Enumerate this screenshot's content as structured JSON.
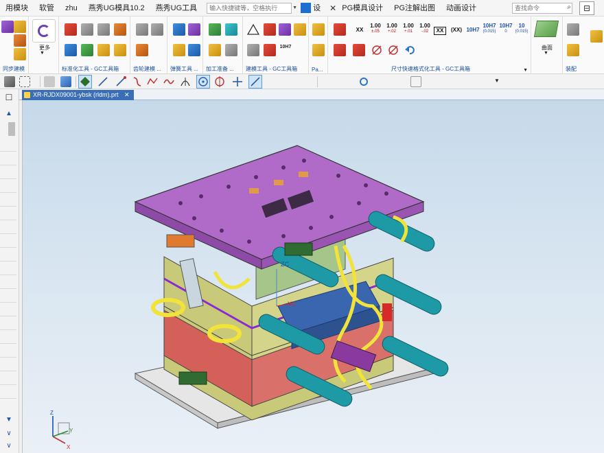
{
  "menubar": {
    "items": [
      "用模块",
      "软管",
      "zhu",
      "燕秀UG模具10.2",
      "燕秀UG工具"
    ],
    "command_placeholder": "输入快捷键等，空格执行",
    "settings_label": "设",
    "right_items": [
      "PG模具设计",
      "PG注解出图",
      "动画设计"
    ],
    "find_placeholder": "查找命令"
  },
  "ribbon": {
    "groups": [
      {
        "label": "同步建模"
      },
      {
        "label": "标准化工具 - GC工具箱"
      },
      {
        "label": "齿轮建模 ..."
      },
      {
        "label": "弹簧工具 ..."
      },
      {
        "label": "加工准备 ..."
      },
      {
        "label": "建模工具 - GC工具箱"
      },
      {
        "label": "Pa..."
      },
      {
        "label": "尺寸快速格式化工具 - GC工具箱"
      },
      {
        "label": "装配"
      }
    ],
    "more_label": "更多",
    "surface_label": "曲面",
    "tolerances": [
      {
        "main": "1.00",
        "sub": "±.05"
      },
      {
        "main": "1.00",
        "sub": "+.02"
      },
      {
        "main": "1.00",
        "sub": "+.01"
      },
      {
        "main": "1.00",
        "sub": "-.02"
      }
    ],
    "xx_label": "XX",
    "xx_box_label": "XX",
    "xx_paren_label": "(XX)",
    "fits": [
      "10H7",
      "10H7",
      "10H7",
      "10"
    ],
    "fit_sub": [
      "",
      "(0.015)",
      "0",
      "(0.015)"
    ],
    "h7_label": "10H7"
  },
  "tab": {
    "title": "XR-RJDX09001-ybsk (rldm).prt"
  },
  "colors": {
    "tab_active": "#3b6fb5",
    "plate_top": "#b06ac8",
    "plate_olive": "#c9c97a",
    "plate_red": "#d4605a",
    "pipe_cyan": "#1d9aa6",
    "hose_yellow": "#f2e33a",
    "base_grey": "#e0e0e0",
    "insert_blue": "#3a66b0"
  },
  "axes": {
    "x": "X",
    "y": "Y",
    "z": "Z"
  },
  "wcs": {
    "x": "XC",
    "z": "ZC"
  }
}
